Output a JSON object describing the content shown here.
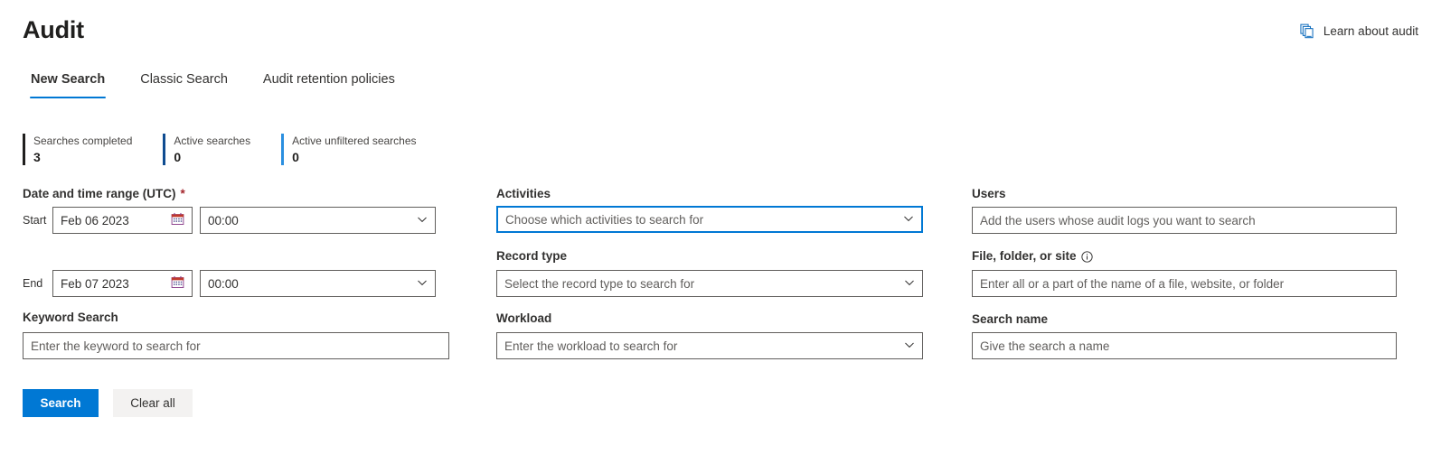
{
  "header": {
    "title": "Audit",
    "learn_link": {
      "label": "Learn about audit",
      "icon": "documents-icon",
      "color": "#0f6cbd"
    }
  },
  "tabs": [
    {
      "label": "New Search",
      "active": true
    },
    {
      "label": "Classic Search",
      "active": false
    },
    {
      "label": "Audit retention policies",
      "active": false
    }
  ],
  "stats": [
    {
      "label": "Searches completed",
      "value": "3",
      "bar_color": "#201f1e"
    },
    {
      "label": "Active searches",
      "value": "0",
      "bar_color": "#0f4c91"
    },
    {
      "label": "Active unfiltered searches",
      "value": "0",
      "bar_color": "#2a8fe0"
    }
  ],
  "form": {
    "date_range": {
      "label": "Date and time range (UTC)",
      "required_marker": "*",
      "start": {
        "row_label": "Start",
        "date_value": "Feb 06 2023",
        "time_value": "00:00",
        "date_icon": "calendar-icon",
        "time_icon": "chevron-down-icon"
      },
      "end": {
        "row_label": "End",
        "date_value": "Feb 07 2023",
        "time_value": "00:00",
        "date_icon": "calendar-icon",
        "time_icon": "chevron-down-icon"
      }
    },
    "keyword_search": {
      "label": "Keyword Search",
      "placeholder": "Enter the keyword to search for",
      "value": ""
    },
    "activities": {
      "label": "Activities",
      "placeholder": "Choose which activities to search for",
      "value": "",
      "focused": true,
      "icon": "chevron-down-icon"
    },
    "record_type": {
      "label": "Record type",
      "placeholder": "Select the record type to search for",
      "value": "",
      "icon": "chevron-down-icon"
    },
    "workload": {
      "label": "Workload",
      "placeholder": "Enter the workload to search for",
      "value": "",
      "icon": "chevron-down-icon"
    },
    "users": {
      "label": "Users",
      "placeholder": "Add the users whose audit logs you want to search",
      "value": ""
    },
    "file_folder_site": {
      "label": "File, folder, or site",
      "info_icon": "info-icon",
      "placeholder": "Enter all or a part of the name of a file, website, or folder",
      "value": ""
    },
    "search_name": {
      "label": "Search name",
      "placeholder": "Give the search a name",
      "value": ""
    },
    "buttons": {
      "search": "Search",
      "clear_all": "Clear all"
    }
  },
  "colors": {
    "accent": "#0078d4",
    "focus_border": "#0078d4",
    "required": "#a4262c",
    "field_border": "#605e5c",
    "placeholder": "#605e5c",
    "neutral_button": "#f3f2f1"
  }
}
